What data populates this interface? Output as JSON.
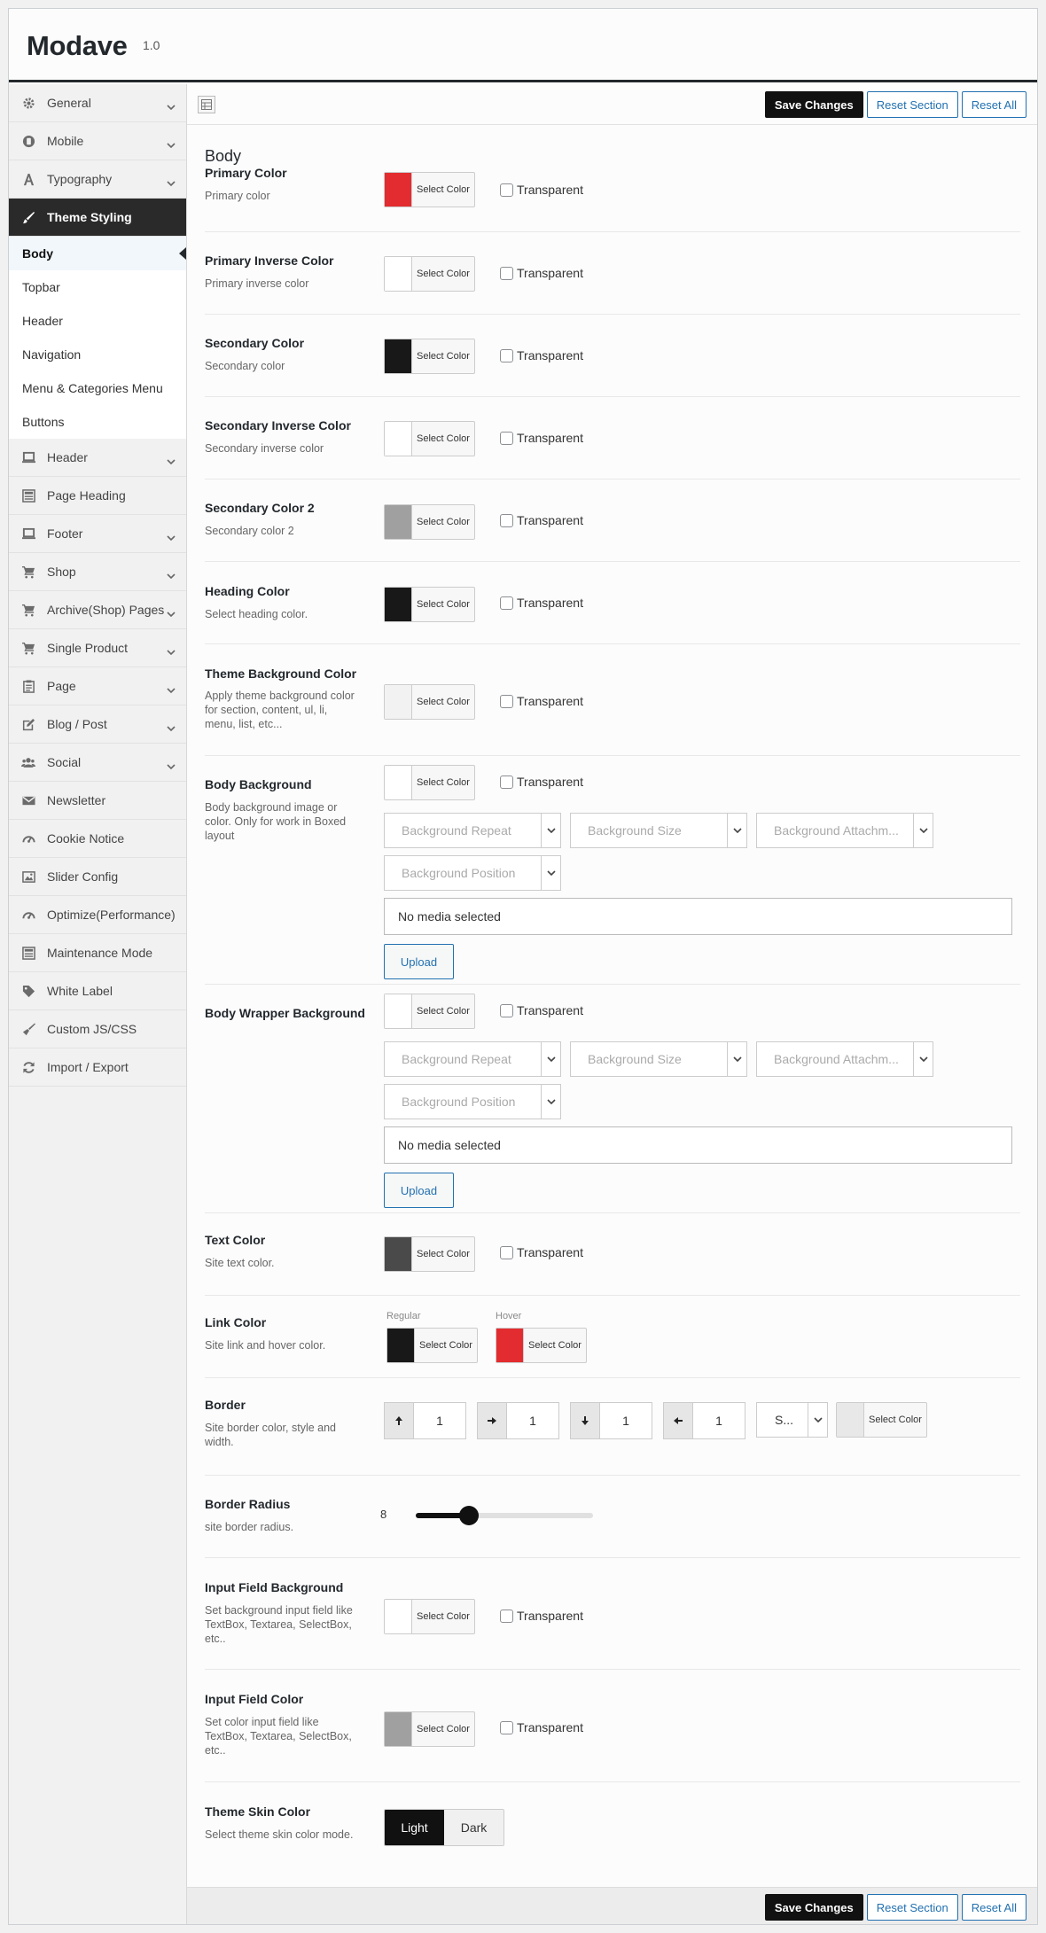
{
  "app": {
    "title": "Modave",
    "version": "1.0"
  },
  "sidebar": {
    "items_top": [
      {
        "label": "General",
        "icon": "gear-icon",
        "chevron": true
      },
      {
        "label": "Mobile",
        "icon": "mobile-icon",
        "chevron": true
      },
      {
        "label": "Typography",
        "icon": "font-icon",
        "chevron": true
      },
      {
        "label": "Theme Styling",
        "icon": "brush-icon",
        "chevron": false,
        "active": true
      }
    ],
    "subitems": [
      "Body",
      "Topbar",
      "Header",
      "Navigation",
      "Menu & Categories Menu",
      "Buttons"
    ],
    "items_bottom": [
      {
        "label": "Header",
        "icon": "laptop-icon",
        "chevron": true
      },
      {
        "label": "Page Heading",
        "icon": "layout-icon",
        "chevron": false
      },
      {
        "label": "Footer",
        "icon": "laptop-icon",
        "chevron": true
      },
      {
        "label": "Shop",
        "icon": "cart-icon",
        "chevron": true
      },
      {
        "label": "Archive(Shop) Pages",
        "icon": "cart-icon",
        "chevron": true
      },
      {
        "label": "Single Product",
        "icon": "cart-icon",
        "chevron": true
      },
      {
        "label": "Page",
        "icon": "clipboard-icon",
        "chevron": true
      },
      {
        "label": "Blog / Post",
        "icon": "edit-icon",
        "chevron": true
      },
      {
        "label": "Social",
        "icon": "users-icon",
        "chevron": true
      },
      {
        "label": "Newsletter",
        "icon": "mail-icon",
        "chevron": false
      },
      {
        "label": "Cookie Notice",
        "icon": "gauge-icon",
        "chevron": false
      },
      {
        "label": "Slider Config",
        "icon": "image-icon",
        "chevron": false
      },
      {
        "label": "Optimize(Performance)",
        "icon": "gauge-icon",
        "chevron": false
      },
      {
        "label": "Maintenance Mode",
        "icon": "layout-icon",
        "chevron": false
      },
      {
        "label": "White Label",
        "icon": "tag-icon",
        "chevron": false
      },
      {
        "label": "Custom JS/CSS",
        "icon": "broom-icon",
        "chevron": false
      },
      {
        "label": "Import / Export",
        "icon": "refresh-icon",
        "chevron": false
      }
    ]
  },
  "toolbar": {
    "save": "Save Changes",
    "reset_section": "Reset Section",
    "reset_all": "Reset All"
  },
  "section": {
    "title": "Body"
  },
  "labels": {
    "select_color": "Select Color",
    "transparent": "Transparent",
    "no_media": "No media selected",
    "upload": "Upload",
    "regular": "Regular",
    "hover": "Hover"
  },
  "options": {
    "primary": {
      "title": "Primary Color",
      "desc": "Primary color",
      "color": "#e32c2f"
    },
    "primary_inverse": {
      "title": "Primary Inverse Color",
      "desc": "Primary inverse color",
      "color": "#ffffff"
    },
    "secondary": {
      "title": "Secondary Color",
      "desc": "Secondary color",
      "color": "#181818"
    },
    "secondary_inverse": {
      "title": "Secondary Inverse Color",
      "desc": "Secondary inverse color",
      "color": "#ffffff"
    },
    "secondary2": {
      "title": "Secondary Color 2",
      "desc": "Secondary color 2",
      "color": "#a0a0a0"
    },
    "heading": {
      "title": "Heading Color",
      "desc": "Select heading color.",
      "color": "#181818"
    },
    "theme_bg": {
      "title": "Theme Background Color",
      "desc": "Apply theme background color for section, content, ul, li, menu, list, etc...",
      "color": "#f2f2f2"
    },
    "body_bg": {
      "title": "Body Background",
      "desc": "Body background image or color. Only for work in Boxed layout",
      "color": "#ffffff",
      "repeat": "Background Repeat",
      "size": "Background Size",
      "attachment": "Background Attachm...",
      "position": "Background Position"
    },
    "wrapper_bg": {
      "title": "Body Wrapper Background",
      "color": "#ffffff",
      "repeat": "Background Repeat",
      "size": "Background Size",
      "attachment": "Background Attachm...",
      "position": "Background Position"
    },
    "text": {
      "title": "Text Color",
      "desc": "Site text color.",
      "color": "#4a4a4a"
    },
    "link": {
      "title": "Link Color",
      "desc": "Site link and hover color.",
      "regular": "#181818",
      "hover": "#e32c2f"
    },
    "border": {
      "title": "Border",
      "desc": "Site border color, style and width.",
      "top": "1",
      "right": "1",
      "bottom": "1",
      "left": "1",
      "style": "S...",
      "color": "#e8e8e8"
    },
    "radius": {
      "title": "Border Radius",
      "desc": "site border radius.",
      "value": "8",
      "fraction": 0.3
    },
    "input_bg": {
      "title": "Input Field Background",
      "desc": "Set background input field like TextBox, Textarea, SelectBox, etc..",
      "color": "#ffffff"
    },
    "input_color": {
      "title": "Input Field Color",
      "desc": "Set color input field like TextBox, Textarea, SelectBox, etc..",
      "color": "#a0a0a0"
    },
    "skin": {
      "title": "Theme Skin Color",
      "desc": "Select theme skin color mode.",
      "light": "Light",
      "dark": "Dark",
      "selected": "Light"
    }
  }
}
